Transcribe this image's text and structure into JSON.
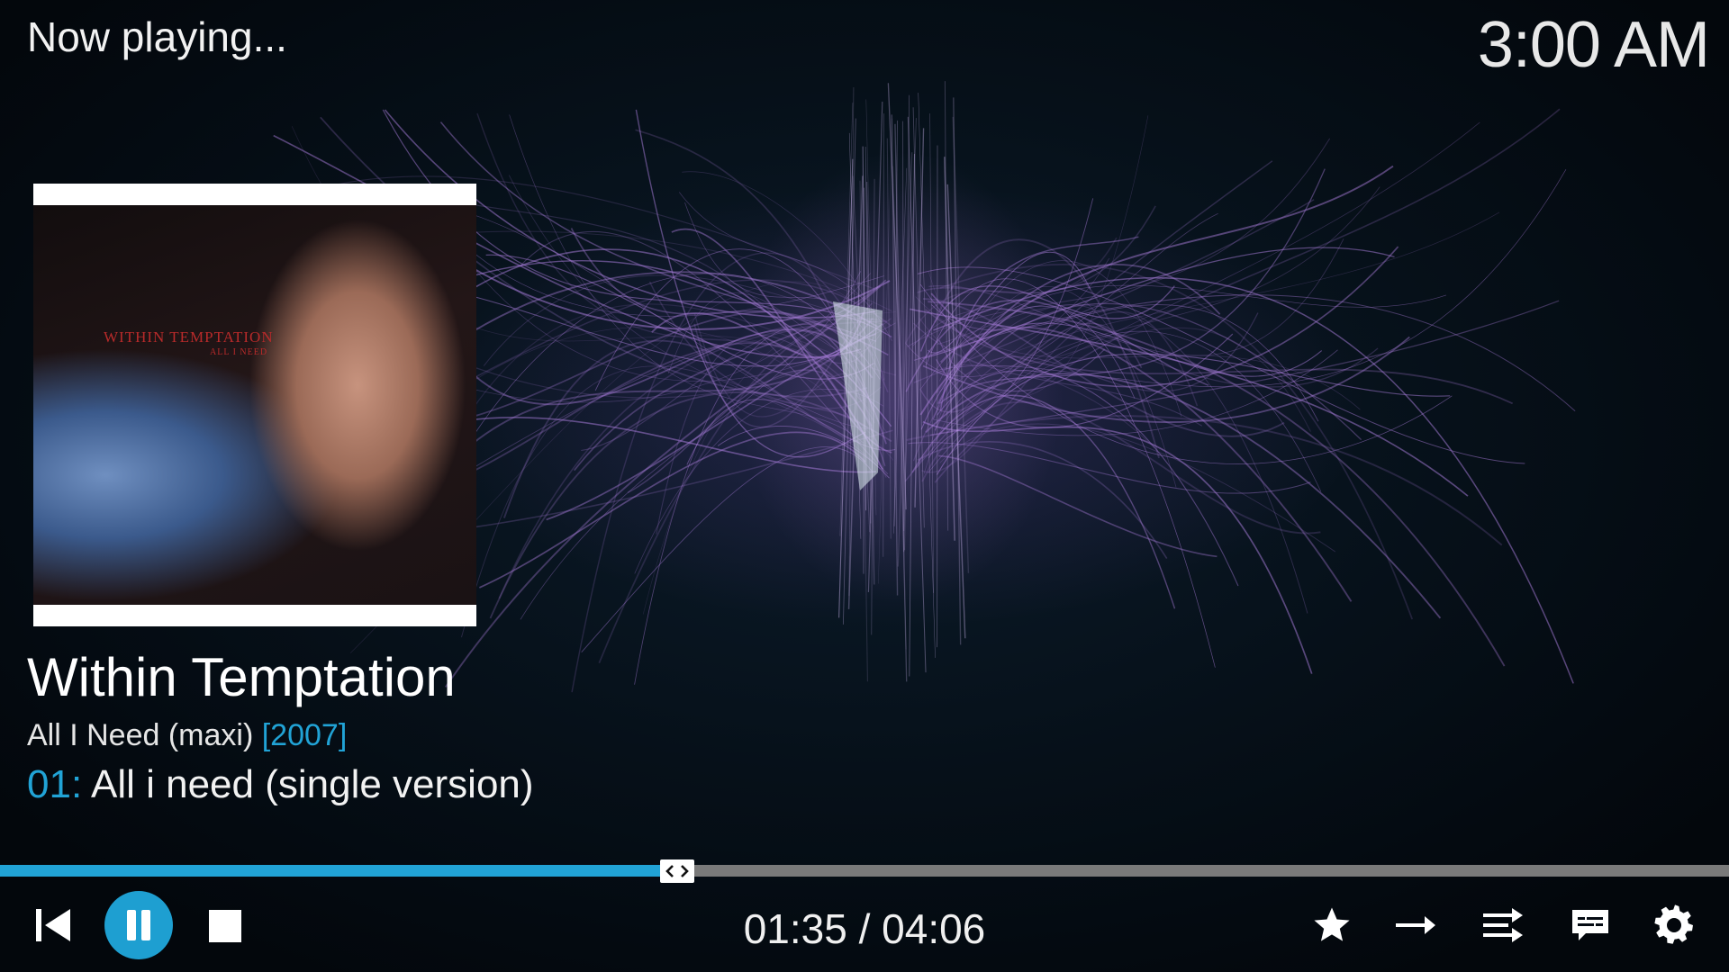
{
  "header": {
    "title": "Now playing...",
    "clock": "3:00 AM"
  },
  "cover": {
    "line1": "WITHIN TEMPTATION",
    "line2": "ALL I NEED"
  },
  "info": {
    "artist": "Within Temptation",
    "album": "All I Need (maxi)",
    "year": "[2007]",
    "track_number": "01:",
    "track_title": "All i need (single version)"
  },
  "playback": {
    "progress": 0.386,
    "time": "01:35 / 04:06"
  },
  "colors": {
    "accent": "#21a3d6",
    "progress_track": "#7a7a7a",
    "visualizer": "#a57ad6"
  },
  "icons": {
    "prev": "skip-previous-icon",
    "pause": "pause-icon",
    "stop": "stop-icon",
    "favourite": "star-icon",
    "repeat": "arrow-right-icon",
    "shuffle": "shuffle-icon",
    "subtitles": "subtitles-icon",
    "settings": "gear-icon"
  }
}
